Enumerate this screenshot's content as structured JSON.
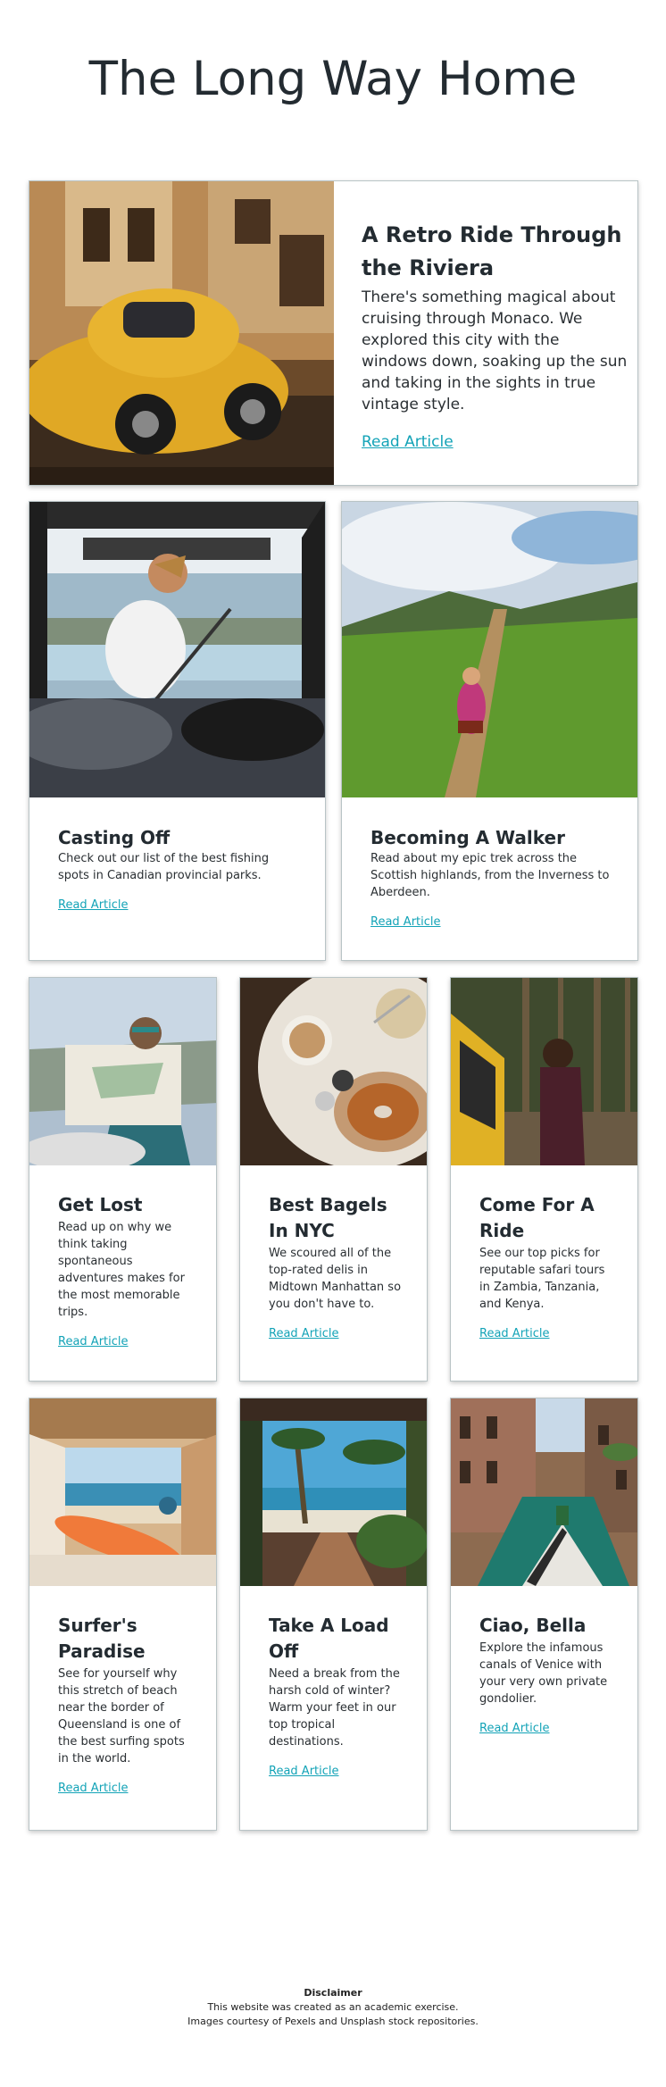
{
  "site": {
    "title": "The Long Way Home"
  },
  "featured": {
    "title": "A Retro Ride Through the Riviera",
    "text": "There's something magical about cruising through Monaco. We explored this city with the windows down, soaking up the sun and taking in the sights in true vintage style.",
    "link": "Read Article",
    "image": "yellow vintage beetle car on street"
  },
  "articles_row2": [
    {
      "title": "Casting Off",
      "text": "Check out our list of the best fishing spots in Canadian provincial parks.",
      "link": "Read Article",
      "image": "man fishing from van back"
    },
    {
      "title": "Becoming A Walker",
      "text": "Read about my epic trek across the Scottish highlands, from the Inverness to Aberdeen.",
      "link": "Read Article",
      "image": "hiker on green mountain ridge"
    }
  ],
  "articles_row3": [
    {
      "title": "Get Lost",
      "text": "Read up on why we think taking spontaneous adventures makes for the most memorable trips.",
      "link": "Read Article",
      "image": "person reading map"
    },
    {
      "title": "Best Bagels In NYC",
      "text": "We scoured all of the top-rated delis in Midtown Manhattan so you don't have to.",
      "link": "Read Article",
      "image": "bagel and coffee on table"
    },
    {
      "title": "Come For A Ride",
      "text": "See our top picks for reputable safari tours in Zambia, Tanzania, and Kenya.",
      "link": "Read Article",
      "image": "woman beside yellow van in forest"
    }
  ],
  "articles_row4": [
    {
      "title": "Surfer's Paradise",
      "text": "See for yourself why this stretch of beach near the border of Queensland is one of the best surfing spots in the world.",
      "link": "Read Article",
      "image": "surfboard in van facing beach"
    },
    {
      "title": "Take A Load Off",
      "text": "Need a break from the harsh cold of winter? Warm your feet in our top tropical destinations.",
      "link": "Read Article",
      "image": "tropical beach boardwalk with palms"
    },
    {
      "title": "Ciao, Bella",
      "text": "Explore the infamous canals of Venice with your very own private gondolier.",
      "link": "Read Article",
      "image": "venice canal with gondola"
    }
  ],
  "footer": {
    "heading": "Disclaimer",
    "line1": "This website was created as an academic exercise.",
    "line2": "Images courtesy of Pexels and Unsplash stock repositories."
  }
}
